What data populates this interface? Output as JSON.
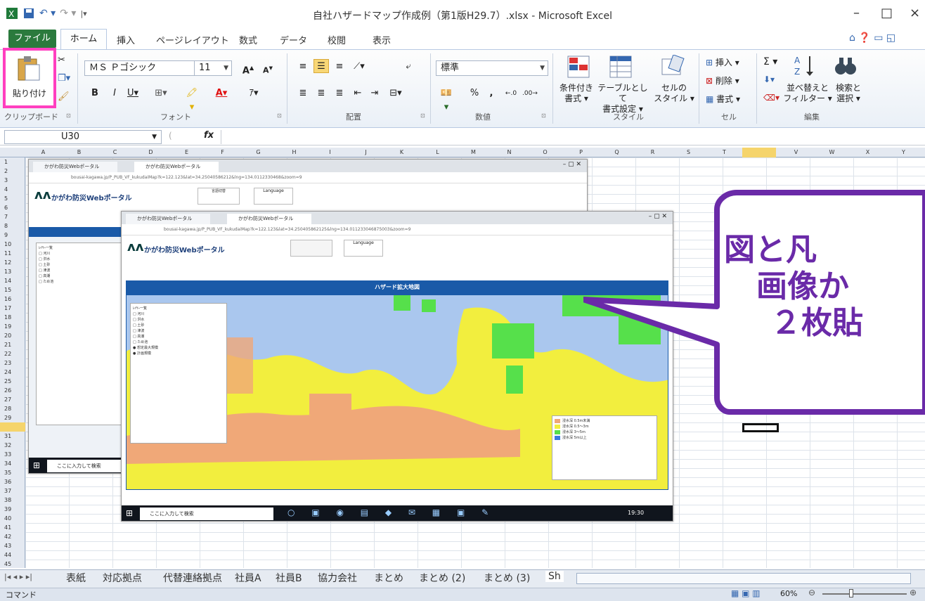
{
  "window": {
    "title": "自社ハザードマップ作成例（第1版H29.7）.xlsx - Microsoft Excel",
    "minimize": "–",
    "maximize": "□",
    "close": "×"
  },
  "ribbon_tabs": [
    "ファイル",
    "ホーム",
    "挿入",
    "ページレイアウト",
    "数式",
    "データ",
    "校閲",
    "表示"
  ],
  "clipboard": {
    "paste_label": "貼り付け",
    "group_label": "クリップボード"
  },
  "font": {
    "name": "ＭＳ Ｐゴシック",
    "size": "11",
    "group_label": "フォント"
  },
  "alignment": {
    "group_label": "配置"
  },
  "number": {
    "format": "標準",
    "group_label": "数値",
    "percent": "%",
    "comma": ","
  },
  "styles": {
    "cond_format": "条件付き\n書式 ▾",
    "as_table": "テーブルとして\n書式設定 ▾",
    "cell_styles": "セルの\nスタイル ▾",
    "group_label": "スタイル"
  },
  "cells": {
    "insert": "挿入 ▾",
    "delete": "削除 ▾",
    "format": "書式 ▾",
    "group_label": "セル"
  },
  "editing": {
    "sum": "Σ ▾",
    "sort_filter": "並べ替えと\nフィルター ▾",
    "find_select": "検索と\n選択 ▾",
    "group_label": "編集"
  },
  "formula_bar": {
    "name_box": "U30",
    "fx": "fx",
    "value": ""
  },
  "columns": [
    "A",
    "B",
    "C",
    "D",
    "E",
    "F",
    "G",
    "H",
    "I",
    "J",
    "K",
    "L",
    "M",
    "N",
    "O",
    "P",
    "Q",
    "R",
    "S",
    "T",
    "U",
    "V",
    "W",
    "X",
    "Y"
  ],
  "rows": [
    "1",
    "2",
    "3",
    "4",
    "5",
    "6",
    "7",
    "8",
    "9",
    "10",
    "11",
    "12",
    "13",
    "14",
    "15",
    "16",
    "17",
    "18",
    "19",
    "20",
    "21",
    "22",
    "23",
    "24",
    "25",
    "26",
    "27",
    "28",
    "29",
    "30",
    "31",
    "32",
    "33",
    "34",
    "35",
    "36",
    "37",
    "38",
    "39",
    "40",
    "41",
    "42",
    "43",
    "44",
    "45"
  ],
  "screenshot_back": {
    "tab1": "かがわ防災Webポータル",
    "tab2": "かがわ防災Webポータル",
    "url": "bousai-kagawa.jp/P_PUB_VF_kukudaiMap?k=122.123&lat=34.25040586212&lng=134.0112330468&zoom=9",
    "portal": "かがわ防災Webポータル",
    "layer_button": "言語切替",
    "language": "Language",
    "search": "ここに入力して検索"
  },
  "screenshot_front": {
    "tab1": "かがわ防災Webポータル",
    "tab2": "かがわ防災Webポータル",
    "url": "bousai-kagawa.jp/P_PUB_VF_kukudaiMap?k=122.123&lat=34.250405862125&lng=134.011233046875003&zoom=9",
    "portal": "かがわ防災Webポータル",
    "language": "Language",
    "map_title": "ハザード拡大地図",
    "search": "ここに入力して検索",
    "clock": "19:30"
  },
  "callout": {
    "line1": "図と凡",
    "line2": "画像か",
    "line3": "２枚貼"
  },
  "sheet_tabs": [
    "表紙",
    "対応拠点",
    "代替連絡拠点",
    "社員A",
    "社員B",
    "協力会社",
    "まとめ",
    "まとめ (2)",
    "まとめ (3)",
    "Sh"
  ],
  "status": {
    "mode": "コマンド",
    "zoom": "60%"
  },
  "colors": {
    "file_tab": "#2b7a3d",
    "highlight": "#ff3fbf",
    "callout": "#6a2aa8",
    "map_header": "#1a5aa8"
  }
}
